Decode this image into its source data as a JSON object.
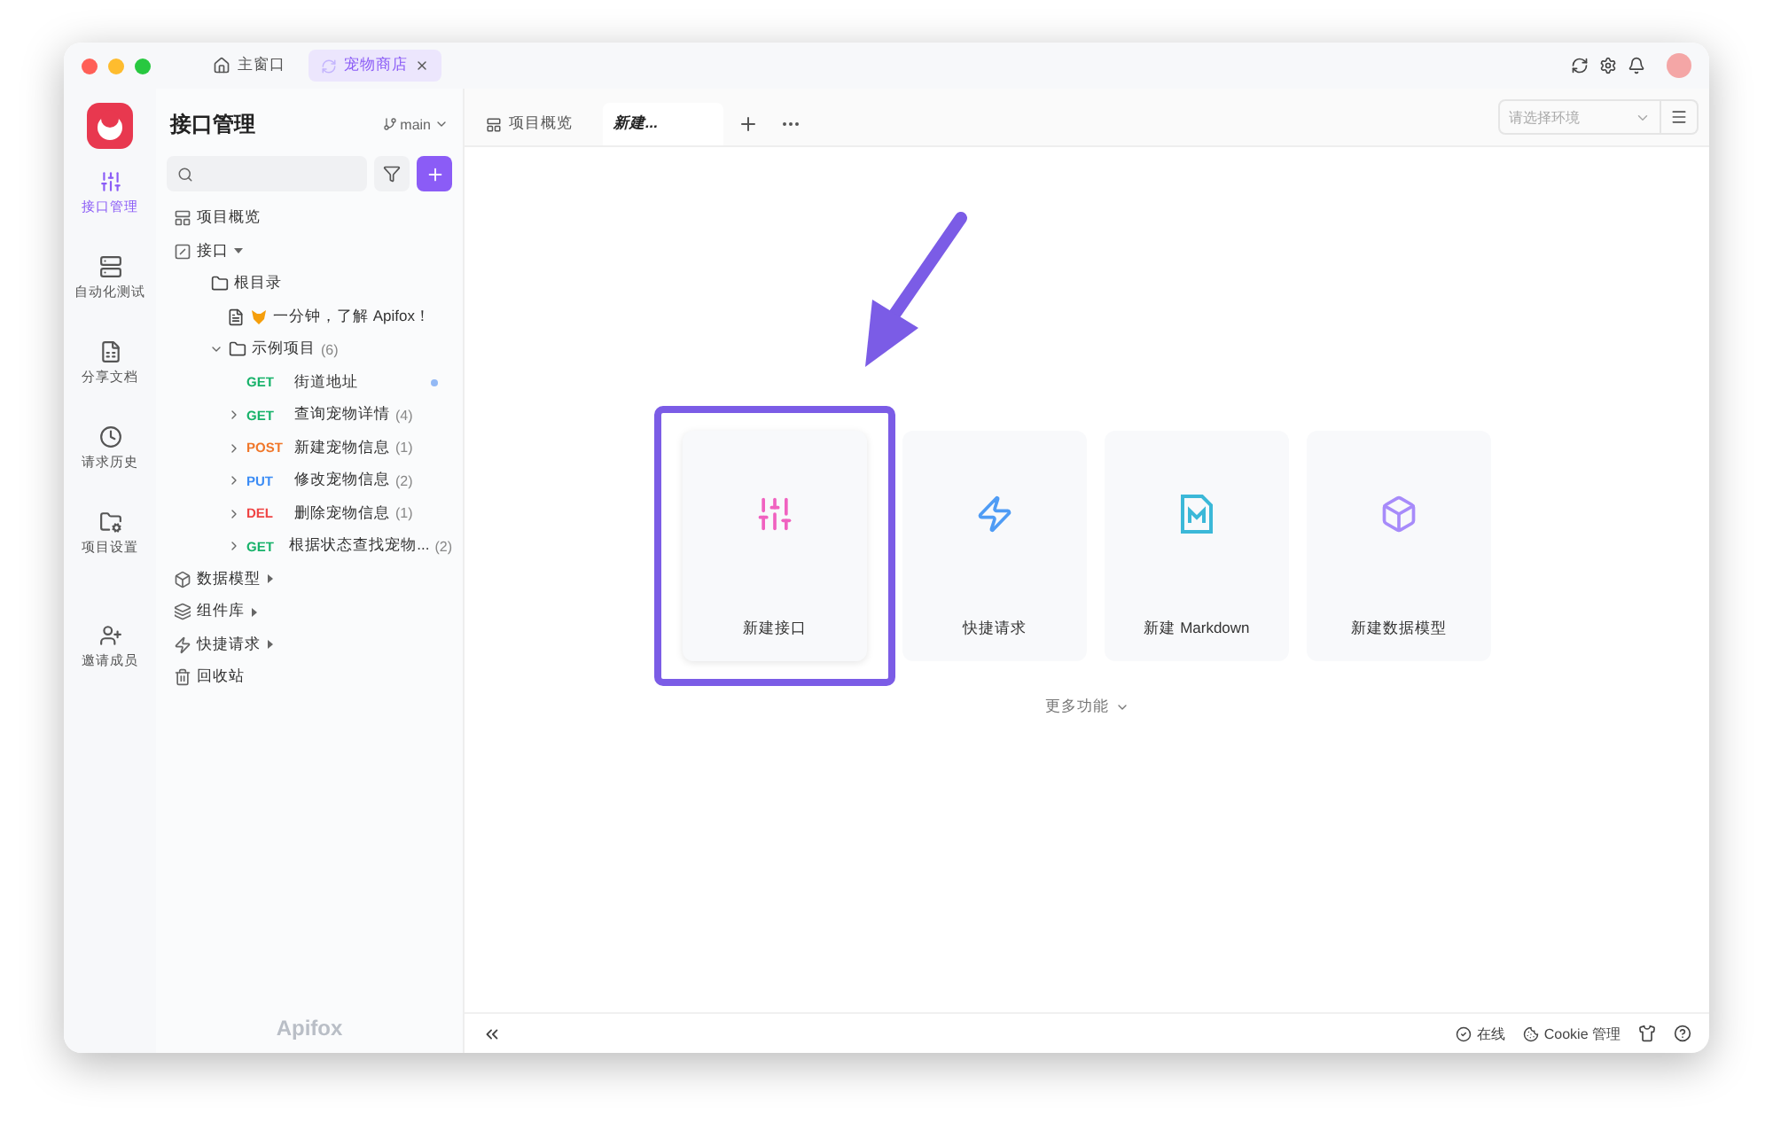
{
  "window_tabs": [
    {
      "label": "主窗口",
      "selected": false
    },
    {
      "label": "宠物商店",
      "selected": true
    }
  ],
  "nav_rail": [
    {
      "label": "接口管理",
      "selected": true
    },
    {
      "label": "自动化测试",
      "selected": false
    },
    {
      "label": "分享文档",
      "selected": false
    },
    {
      "label": "请求历史",
      "selected": false
    },
    {
      "label": "项目设置",
      "selected": false
    },
    {
      "label": "邀请成员",
      "selected": false
    }
  ],
  "sidebar": {
    "title": "接口管理",
    "branch": "main",
    "brand": "Apifox",
    "tree": [
      {
        "kind": "section",
        "label": "项目概览"
      },
      {
        "kind": "section",
        "label": "接口",
        "expanded": true,
        "children": [
          {
            "kind": "folder",
            "label": "根目录",
            "children": [
              {
                "kind": "doc",
                "label": "一分钟，了解 Apifox！"
              },
              {
                "kind": "folder",
                "label": "示例项目",
                "count": "(6)",
                "expanded": true,
                "children": [
                  {
                    "kind": "endpoint",
                    "method": "GET",
                    "color": "#17b26a",
                    "label": "街道地址",
                    "modified": true
                  },
                  {
                    "kind": "endpoint",
                    "method": "GET",
                    "color": "#17b26a",
                    "label": "查询宠物详情",
                    "count": "(4)",
                    "expanded": false,
                    "modified": false
                  },
                  {
                    "kind": "endpoint",
                    "method": "POST",
                    "color": "#f0772a",
                    "label": "新建宠物信息",
                    "count": "(1)",
                    "expanded": false,
                    "modified": false
                  },
                  {
                    "kind": "endpoint",
                    "method": "PUT",
                    "color": "#3b8cf5",
                    "label": "修改宠物信息",
                    "count": "(2)",
                    "expanded": false,
                    "modified": false
                  },
                  {
                    "kind": "endpoint",
                    "method": "DEL",
                    "color": "#ef4444",
                    "label": "删除宠物信息",
                    "count": "(1)",
                    "expanded": false,
                    "modified": false
                  },
                  {
                    "kind": "endpoint",
                    "method": "GET",
                    "color": "#17b26a",
                    "label": "根据状态查找宠物...",
                    "count": "(2)",
                    "expanded": false,
                    "modified": false
                  }
                ]
              }
            ]
          }
        ]
      },
      {
        "kind": "section",
        "label": "数据模型",
        "expanded": false
      },
      {
        "kind": "section",
        "label": "组件库",
        "expanded": false
      },
      {
        "kind": "section",
        "label": "快捷请求",
        "expanded": false
      },
      {
        "kind": "section",
        "label": "回收站"
      }
    ]
  },
  "tabs": [
    {
      "label": "项目概览",
      "selected": false
    },
    {
      "label": "新建...",
      "selected": true
    }
  ],
  "environment": {
    "placeholder": "请选择环境"
  },
  "cards": [
    {
      "label": "新建接口",
      "color": "#f062c0",
      "highlighted": true
    },
    {
      "label": "快捷请求",
      "color": "#4f9cf5",
      "highlighted": false
    },
    {
      "label": "新建 Markdown",
      "color": "#3bb8d8",
      "highlighted": false
    },
    {
      "label": "新建数据模型",
      "color": "#a78bfa",
      "highlighted": false
    }
  ],
  "more": "更多功能",
  "status_bar": {
    "online": "在线",
    "cookie": "Cookie 管理"
  }
}
